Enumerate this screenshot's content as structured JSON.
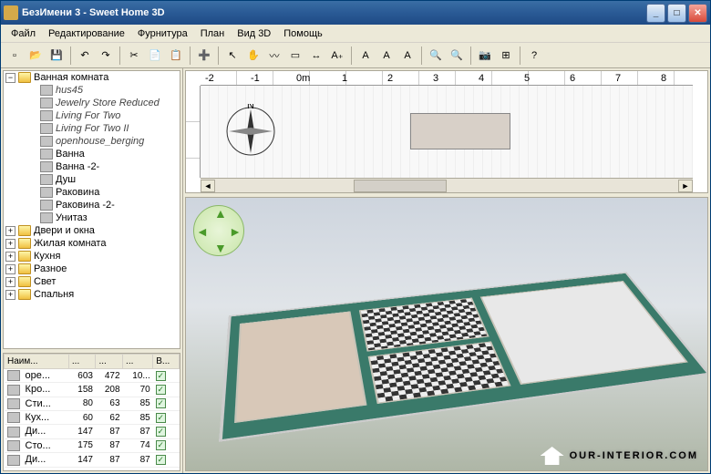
{
  "title": "БезИмени 3 - Sweet Home 3D",
  "menu": [
    "Файл",
    "Редактирование",
    "Фурнитура",
    "План",
    "Вид 3D",
    "Помощь"
  ],
  "toolbar_icons": [
    "document-new-icon",
    "open-icon",
    "save-icon",
    "undo-icon",
    "redo-icon",
    "cut-icon",
    "copy-icon",
    "paste-icon",
    "add-furniture-icon",
    "select-icon",
    "pan-icon",
    "wall-icon",
    "room-icon",
    "dimension-icon",
    "text-icon",
    "text-italic-icon",
    "text-bold-icon",
    "text-opts-icon",
    "zoom-in-icon",
    "zoom-out-icon",
    "camera-icon",
    "preferences-icon",
    "help-icon"
  ],
  "toolbar_glyphs": [
    "▫",
    "📂",
    "💾",
    "↶",
    "↷",
    "✂",
    "📄",
    "📋",
    "➕",
    "↖",
    "✋",
    "〰",
    "▭",
    "↔",
    "A₊",
    "A",
    "A",
    "A",
    "🔍",
    "🔍",
    "📷",
    "⊞",
    "?"
  ],
  "tree": {
    "root": {
      "label": "Ванная комната",
      "expanded": true
    },
    "children": [
      {
        "label": "hus45"
      },
      {
        "label": "Jewelry Store Reduced"
      },
      {
        "label": "Living For Two"
      },
      {
        "label": "Living For Two II"
      },
      {
        "label": "openhouse_berging"
      },
      {
        "label": "Ванна",
        "plain": true
      },
      {
        "label": "Ванна -2-",
        "plain": true
      },
      {
        "label": "Душ",
        "plain": true
      },
      {
        "label": "Раковина",
        "plain": true
      },
      {
        "label": "Раковина -2-",
        "plain": true
      },
      {
        "label": "Унитаз",
        "plain": true
      }
    ],
    "siblings": [
      "Двери и окна",
      "Жилая комната",
      "Кухня",
      "Разное",
      "Свет",
      "Спальня"
    ]
  },
  "table": {
    "headers": [
      "Наим...",
      "...",
      "...",
      "...",
      "В..."
    ],
    "rows": [
      {
        "name": "оре...",
        "c1": "603",
        "c2": "472",
        "c3": "10...",
        "vis": true
      },
      {
        "name": "Кро...",
        "c1": "158",
        "c2": "208",
        "c3": "70",
        "vis": true
      },
      {
        "name": "Сти...",
        "c1": "80",
        "c2": "63",
        "c3": "85",
        "vis": true
      },
      {
        "name": "Кух...",
        "c1": "60",
        "c2": "62",
        "c3": "85",
        "vis": true
      },
      {
        "name": "Ди...",
        "c1": "147",
        "c2": "87",
        "c3": "87",
        "vis": true
      },
      {
        "name": "Сто...",
        "c1": "175",
        "c2": "87",
        "c3": "74",
        "vis": true
      },
      {
        "name": "Ди...",
        "c1": "147",
        "c2": "87",
        "c3": "87",
        "vis": true
      }
    ]
  },
  "ruler_marks": [
    "-2",
    "-1",
    "0m",
    "1",
    "2",
    "3",
    "4",
    "5",
    "6",
    "7",
    "8"
  ],
  "compass_label": "N",
  "watermark": "OUR-INTERIOR.COM"
}
